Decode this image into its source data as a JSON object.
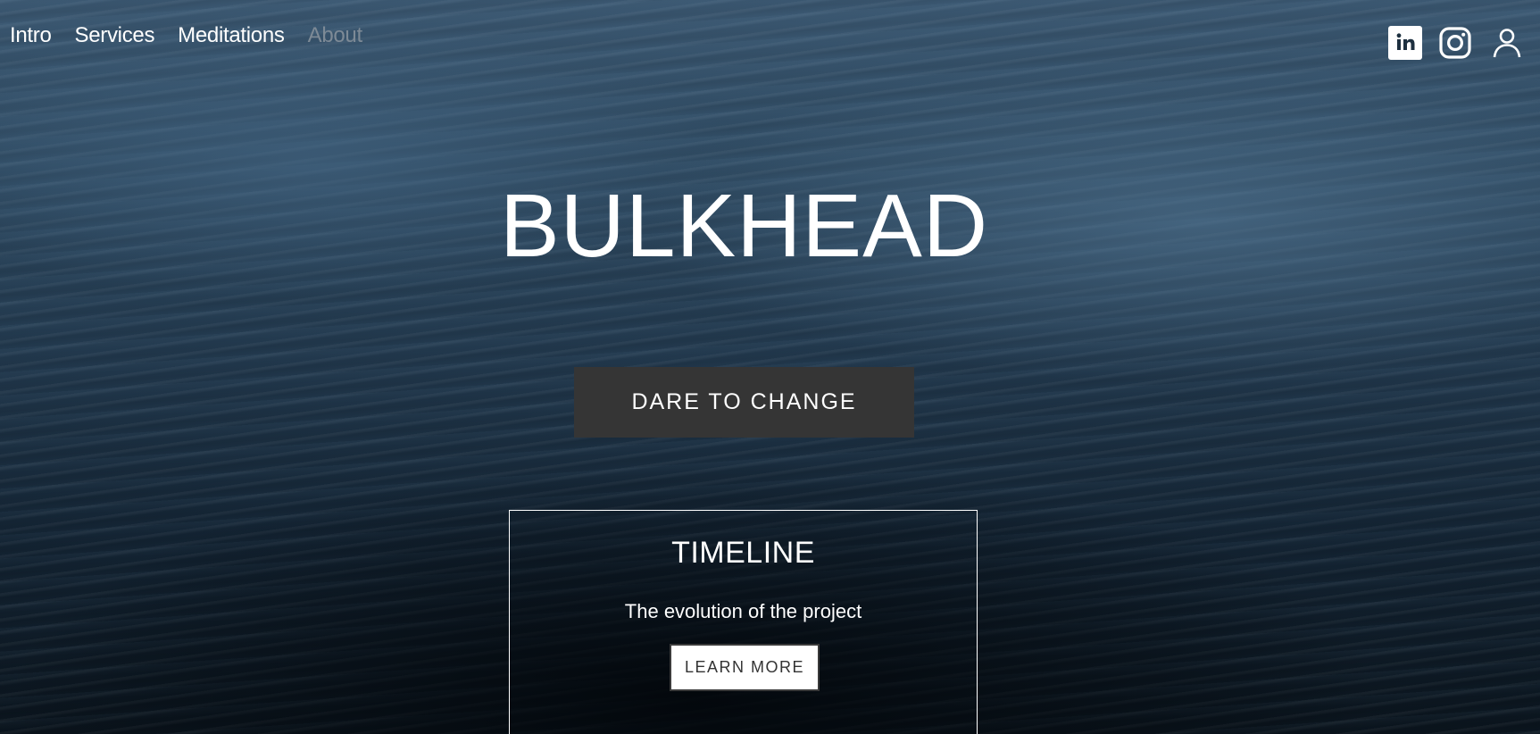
{
  "nav": {
    "items": [
      {
        "label": "Intro"
      },
      {
        "label": "Services"
      },
      {
        "label": "Meditations"
      },
      {
        "label": "About"
      }
    ]
  },
  "socials": {
    "items": [
      {
        "icon": "linkedin-icon"
      },
      {
        "icon": "instagram-icon"
      },
      {
        "icon": "user-icon"
      }
    ]
  },
  "hero": {
    "title": "BULKHEAD",
    "cta_label": "DARE TO CHANGE"
  },
  "timeline": {
    "title": "TIMELINE",
    "subtitle": "The evolution of the project",
    "button_label": "LEARN MORE"
  },
  "colors": {
    "text": "#ffffff",
    "nav_dim": "#7d8a96",
    "cta_bg": "#353535",
    "learn_more_text": "#333333"
  }
}
